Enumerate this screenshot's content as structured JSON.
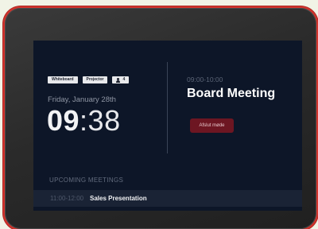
{
  "room": {
    "chips": [
      "Whiteboard",
      "Projector"
    ],
    "capacity": "4",
    "date": "Friday, January 28th",
    "time_hours": "09",
    "time_minutes": ":38"
  },
  "current_meeting": {
    "time": "09:00-10:00",
    "title": "Board Meeting",
    "status_button": "Afslut møde"
  },
  "upcoming": {
    "label": "UPCOMING MEETINGS",
    "items": [
      {
        "time": "11:00-12:00",
        "title": "Sales Presentation"
      }
    ]
  },
  "colors": {
    "device_frame": "#2a2a2a",
    "device_edge": "#d2332c",
    "screen_bg": "#0d1628",
    "status_button_bg": "#6d1622",
    "upcoming_row_bg": "#1a2335"
  }
}
